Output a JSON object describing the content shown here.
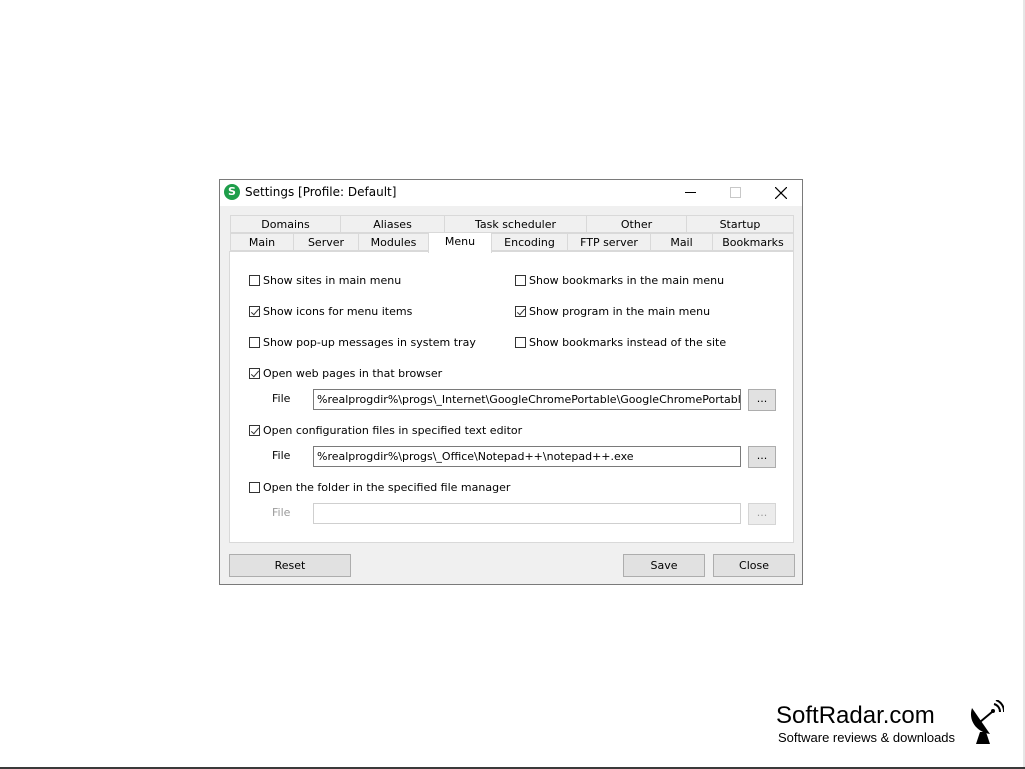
{
  "window": {
    "title": "Settings [Profile: Default]",
    "icon_letter": "S",
    "icon_color": "#1e9e4a",
    "controls": [
      "minimize-icon",
      "maximize-icon",
      "close-icon"
    ]
  },
  "tabs": {
    "row_top": [
      "Domains",
      "Aliases",
      "Task scheduler",
      "Other",
      "Startup"
    ],
    "row_bottom": [
      "Main",
      "Server",
      "Modules",
      "Menu",
      "Encoding",
      "FTP server",
      "Mail",
      "Bookmarks"
    ],
    "active": "Menu"
  },
  "options": {
    "show_sites": {
      "label": "Show sites in main menu",
      "checked": false
    },
    "show_bookmarks_main": {
      "label": "Show bookmarks in the main menu",
      "checked": false
    },
    "show_icons": {
      "label": "Show icons for menu items",
      "checked": true
    },
    "show_program": {
      "label": "Show program in the main menu",
      "checked": true
    },
    "show_popups": {
      "label": "Show pop-up messages in system tray",
      "checked": false
    },
    "show_bookmarks_instead": {
      "label": "Show bookmarks instead of the site",
      "checked": false
    },
    "open_web": {
      "label": "Open web pages in that browser",
      "checked": true
    },
    "open_config": {
      "label": "Open configuration files in specified text editor",
      "checked": true
    },
    "open_folder": {
      "label": "Open the folder in the specified file manager",
      "checked": false
    }
  },
  "files": {
    "browser": {
      "label": "File",
      "value": "%realprogdir%\\progs\\_Internet\\GoogleChromePortable\\GoogleChromePortable.exe",
      "browse": "..."
    },
    "editor": {
      "label": "File",
      "value": "%realprogdir%\\progs\\_Office\\Notepad++\\notepad++.exe",
      "browse": "..."
    },
    "manager": {
      "label": "File",
      "value": "",
      "browse": "..."
    }
  },
  "buttons": {
    "reset": "Reset",
    "save": "Save",
    "close": "Close"
  },
  "watermark": {
    "name": "SoftRadar.com",
    "tagline": "Software reviews & downloads",
    "icon": "satellite-dish-icon"
  }
}
